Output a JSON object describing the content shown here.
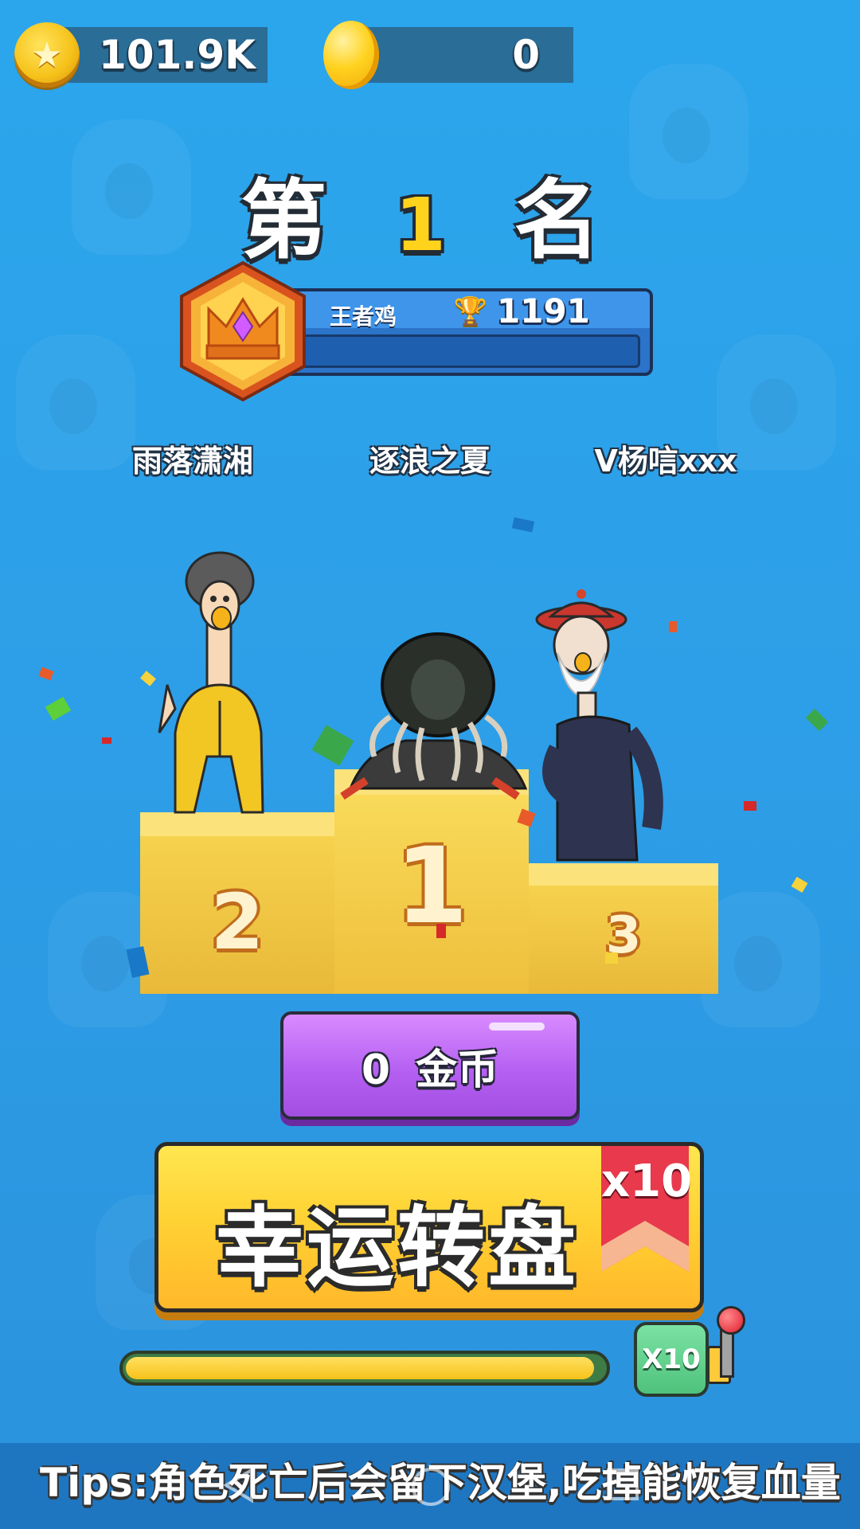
{
  "currencies": {
    "gold": {
      "value": "101.9K",
      "icon": "star-coin-icon"
    },
    "coins": {
      "value": "0",
      "icon": "gold-coin-icon"
    }
  },
  "rank": {
    "prefix": "第",
    "number": "1",
    "suffix": "名"
  },
  "player": {
    "name": "王者鸡",
    "trophies": "1191",
    "progress_fraction": 0.01,
    "badge_icon": "crown-badge-icon"
  },
  "podium": {
    "names": [
      "雨落潇湘",
      "逐浪之夏",
      "V杨唁xxx"
    ],
    "places": [
      "2",
      "1",
      "3"
    ]
  },
  "buttons": {
    "coins_label": "0  金币",
    "spin_label": "幸运转盘",
    "spin_multiplier": "x10",
    "lever_label": "X10"
  },
  "spin_progress_fraction": 0.98,
  "tips": "Tips:角色死亡后会留下汉堡,吃掉能恢复血量",
  "colors": {
    "accent_yellow": "#ffd234",
    "button_purple": "#b560f2",
    "ribbon_red": "#e8394d",
    "background_blue": "#2ba6ec"
  }
}
